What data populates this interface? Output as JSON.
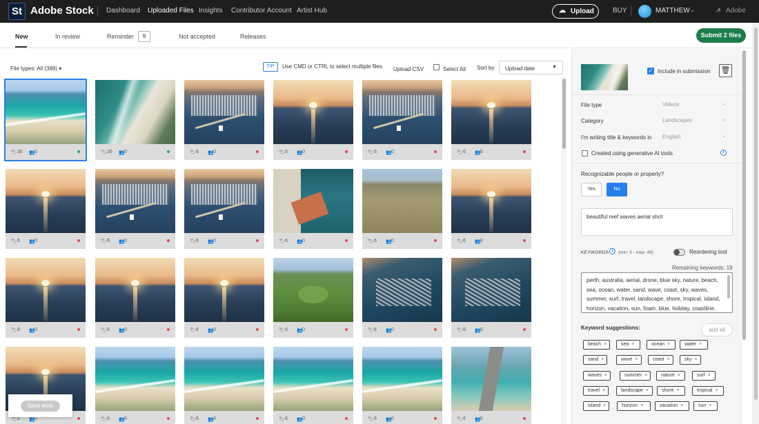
{
  "topnav": {
    "logo": "St",
    "brand": "Adobe Stock",
    "items": [
      "Dashboard",
      "Uploaded Files",
      "Insights",
      "Contributor Account",
      "Artist Hub"
    ],
    "upload_label": "Upload",
    "buy_label": "BUY",
    "user_name": "MATTHEW",
    "adobe_label": "Adobe"
  },
  "subtabs": {
    "tabs": [
      "New",
      "In review",
      "Reminder",
      "Not accepted",
      "Releases"
    ],
    "reminder_count": "9",
    "submit_label": "Submit 2 files"
  },
  "toolbar": {
    "file_types": "File types: All (389)",
    "tip_badge": "TIP",
    "tip_text": "Use CMD or CTRL to select multiple files",
    "upload_csv": "Upload CSV",
    "select_all": "Select All",
    "sort_by": "Sort by",
    "sort_value": "Upload date"
  },
  "colors": {
    "accent": "#2680eb",
    "submit": "#1b7d49",
    "status_ok": "#2fa84f",
    "status_missing": "#e34850"
  },
  "thumbnails": [
    {
      "scene": "coast",
      "tags": "30",
      "people": "0",
      "status": "ok"
    },
    {
      "scene": "beach",
      "tags": "26",
      "people": "0",
      "status": "ok"
    },
    {
      "scene": "marina",
      "tags": "6",
      "people": "0",
      "status": "missing"
    },
    {
      "scene": "sunset",
      "tags": "6",
      "people": "0",
      "status": "missing"
    },
    {
      "scene": "marina",
      "tags": "6",
      "people": "0",
      "status": "missing"
    },
    {
      "scene": "sunset",
      "tags": "6",
      "people": "0",
      "status": "missing"
    },
    {
      "scene": "sunset",
      "tags": "6",
      "people": "0",
      "status": "missing"
    },
    {
      "scene": "marina",
      "tags": "6",
      "people": "0",
      "status": "missing"
    },
    {
      "scene": "marina",
      "tags": "6",
      "people": "0",
      "status": "missing"
    },
    {
      "scene": "roof",
      "tags": "6",
      "people": "0",
      "status": "missing"
    },
    {
      "scene": "sandy",
      "tags": "6",
      "people": "0",
      "status": "missing"
    },
    {
      "scene": "sunset",
      "tags": "6",
      "people": "0",
      "status": "missing"
    },
    {
      "scene": "sunset",
      "tags": "6",
      "people": "0",
      "status": "missing"
    },
    {
      "scene": "sunset",
      "tags": "6",
      "people": "0",
      "status": "missing"
    },
    {
      "scene": "sunset",
      "tags": "6",
      "people": "0",
      "status": "missing"
    },
    {
      "scene": "park",
      "tags": "6",
      "people": "0",
      "status": "missing"
    },
    {
      "scene": "harbor",
      "tags": "6",
      "people": "0",
      "status": "missing"
    },
    {
      "scene": "harbor",
      "tags": "6",
      "people": "0",
      "status": "missing"
    },
    {
      "scene": "sunset",
      "tags": "6",
      "people": "0",
      "status": "missing"
    },
    {
      "scene": "coast",
      "tags": "6",
      "people": "0",
      "status": "missing"
    },
    {
      "scene": "coast",
      "tags": "6",
      "people": "0",
      "status": "missing"
    },
    {
      "scene": "coast",
      "tags": "6",
      "people": "0",
      "status": "missing"
    },
    {
      "scene": "coast",
      "tags": "6",
      "people": "0",
      "status": "missing"
    },
    {
      "scene": "jetty",
      "tags": "6",
      "people": "0",
      "status": "missing"
    }
  ],
  "save_work": "Save work",
  "panel": {
    "include_label": "Include in submission",
    "file_type_label": "File type",
    "file_type_value": "Videos",
    "category_label": "Category",
    "category_value": "Landscapes",
    "language_label": "I'm writing title & keywords in",
    "language_value": "English",
    "genai_label": "Created using generative AI tools",
    "people_question": "Recognizable people or property?",
    "yes_label": "Yes",
    "no_label": "No",
    "title_value": "beautiful reef waves aerial shot",
    "keywords_label": "KEYWORDS",
    "keywords_range": "(min: 5 - max: 49)",
    "reorder_label": "Reordering tool",
    "remaining": "Remaining keywords: 19",
    "keywords_text": "perth, australia, aerial, drone, blue sky, nature, beach, sea, ocean, water, sand, wave, coast, sky, waves, summer, surf, travel, landscape, shore, tropical, island, horizon, vacation, sun, foam, blue, holiday, coastline,",
    "suggestions_label": "Keyword suggestions:",
    "add_all": "add all",
    "suggestions": [
      "beach",
      "sea",
      "ocean",
      "water",
      "sand",
      "wave",
      "coast",
      "sky",
      "waves",
      "summer",
      "nature",
      "surf",
      "travel",
      "landscape",
      "shore",
      "tropical",
      "island",
      "horizon",
      "vacation",
      "sun"
    ]
  }
}
